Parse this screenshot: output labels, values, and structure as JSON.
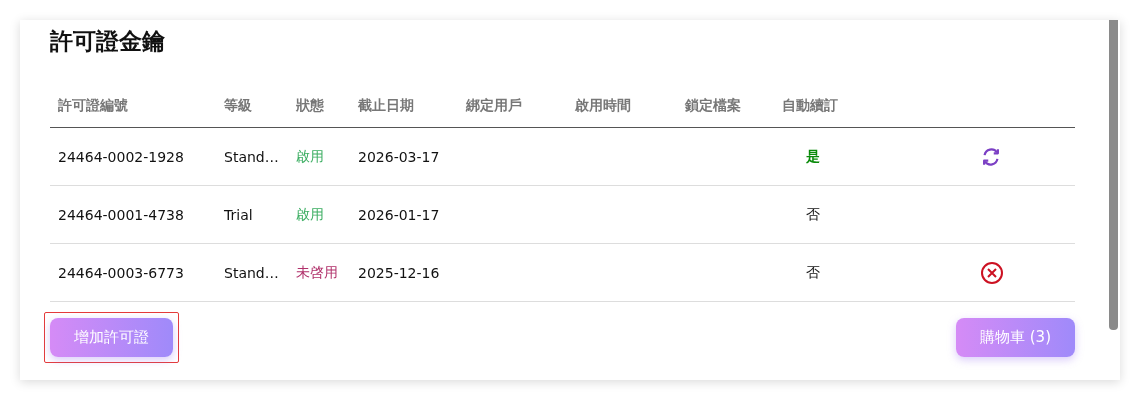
{
  "title": "許可證金鑰",
  "table": {
    "columns": [
      "許可證編號",
      "等級",
      "狀態",
      "截止日期",
      "綁定用戶",
      "啟用時間",
      "鎖定檔案",
      "自動續訂"
    ],
    "rows": [
      {
        "license_no": "24464-0002-1928",
        "tier": "Stand…",
        "status": {
          "text": "啟用",
          "kind": "active"
        },
        "expiry": "2026-03-17",
        "auto_renew": {
          "text": "是",
          "on": true
        },
        "action": {
          "kind": "renew"
        }
      },
      {
        "license_no": "24464-0001-4738",
        "tier": "Trial",
        "status": {
          "text": "啟用",
          "kind": "active"
        },
        "expiry": "2026-01-17",
        "auto_renew": {
          "text": "否",
          "on": false
        }
      },
      {
        "license_no": "24464-0003-6773",
        "tier": "Stand…",
        "status": {
          "text": "未啓用",
          "kind": "inactive"
        },
        "expiry": "2025-12-16",
        "auto_renew": {
          "text": "否",
          "on": false
        },
        "action": {
          "kind": "cancel"
        }
      }
    ]
  },
  "add_button": {
    "label": "增加許可證",
    "highlighted": true
  },
  "cart_button": {
    "label": "購物車 (3)"
  }
}
